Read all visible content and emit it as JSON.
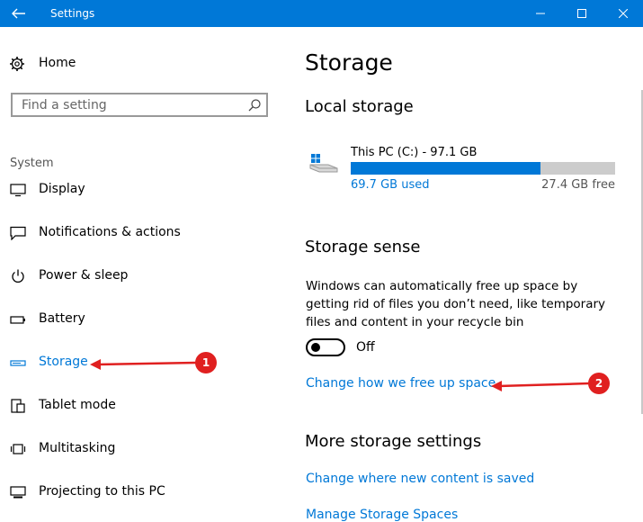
{
  "window": {
    "title": "Settings"
  },
  "sidebar": {
    "home_label": "Home",
    "search_placeholder": "Find a setting",
    "section": "System",
    "items": [
      {
        "label": "Display",
        "icon": "display-icon"
      },
      {
        "label": "Notifications & actions",
        "icon": "notifications-icon"
      },
      {
        "label": "Power & sleep",
        "icon": "power-icon"
      },
      {
        "label": "Battery",
        "icon": "battery-icon"
      },
      {
        "label": "Storage",
        "icon": "storage-icon",
        "active": true
      },
      {
        "label": "Tablet mode",
        "icon": "tablet-mode-icon"
      },
      {
        "label": "Multitasking",
        "icon": "multitasking-icon"
      },
      {
        "label": "Projecting to this PC",
        "icon": "projecting-icon"
      }
    ]
  },
  "main": {
    "title": "Storage",
    "local_storage_heading": "Local storage",
    "drive": {
      "name": "This PC (C:) - 97.1 GB",
      "used": "69.7 GB used",
      "free": "27.4 GB free",
      "used_fraction": 0.718
    },
    "storage_sense_heading": "Storage sense",
    "storage_sense_desc": "Windows can automatically free up space by getting rid of files you don’t need, like temporary files and content in your recycle bin",
    "toggle_state": "Off",
    "change_free_up_link": "Change how we free up space",
    "more_settings_heading": "More storage settings",
    "change_new_content_link": "Change where new content is saved",
    "manage_spaces_link": "Manage Storage Spaces"
  },
  "annotations": {
    "badge_1": "1",
    "badge_2": "2",
    "color": "#e02020"
  },
  "colors": {
    "accent": "#0078d7",
    "titlebar": "#0078d7"
  }
}
